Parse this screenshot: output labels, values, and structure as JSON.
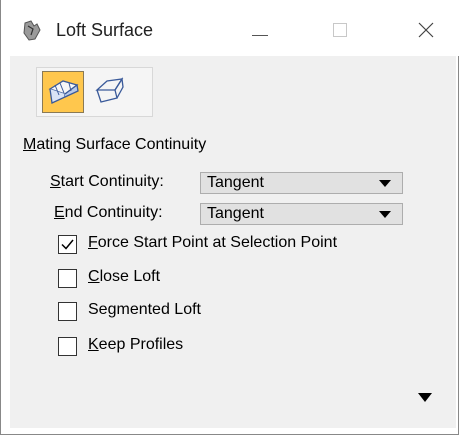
{
  "window": {
    "title": "Loft Surface",
    "minimize_icon": "minimize-icon",
    "maximize_icon": "maximize-icon",
    "close_icon": "close-icon"
  },
  "tools": [
    {
      "name": "loft-surface-tool",
      "icon": "loft-surface-icon",
      "active": true
    },
    {
      "name": "loft-open-tool",
      "icon": "loft-open-icon",
      "active": false
    }
  ],
  "section": {
    "prefix": "M",
    "rest": "ating Surface Continuity"
  },
  "start_continuity": {
    "label_prefix": "S",
    "label_rest": "tart Continuity:",
    "value": "Tangent"
  },
  "end_continuity": {
    "label_prefix": "E",
    "label_rest": "nd Continuity:",
    "value": "Tangent"
  },
  "options": [
    {
      "pre": "",
      "key": "F",
      "post": "orce Start Point at Selection Point",
      "checked": true
    },
    {
      "pre": "",
      "key": "C",
      "post": "lose Loft",
      "checked": false
    },
    {
      "pre": "Se",
      "key": "g",
      "post": "mented Loft",
      "checked": false
    },
    {
      "pre": "",
      "key": "K",
      "post": "eep Profiles",
      "checked": false
    }
  ],
  "colors": {
    "active_tool_bg": "#ffc74d",
    "panel_bg": "#f0f0f0"
  }
}
